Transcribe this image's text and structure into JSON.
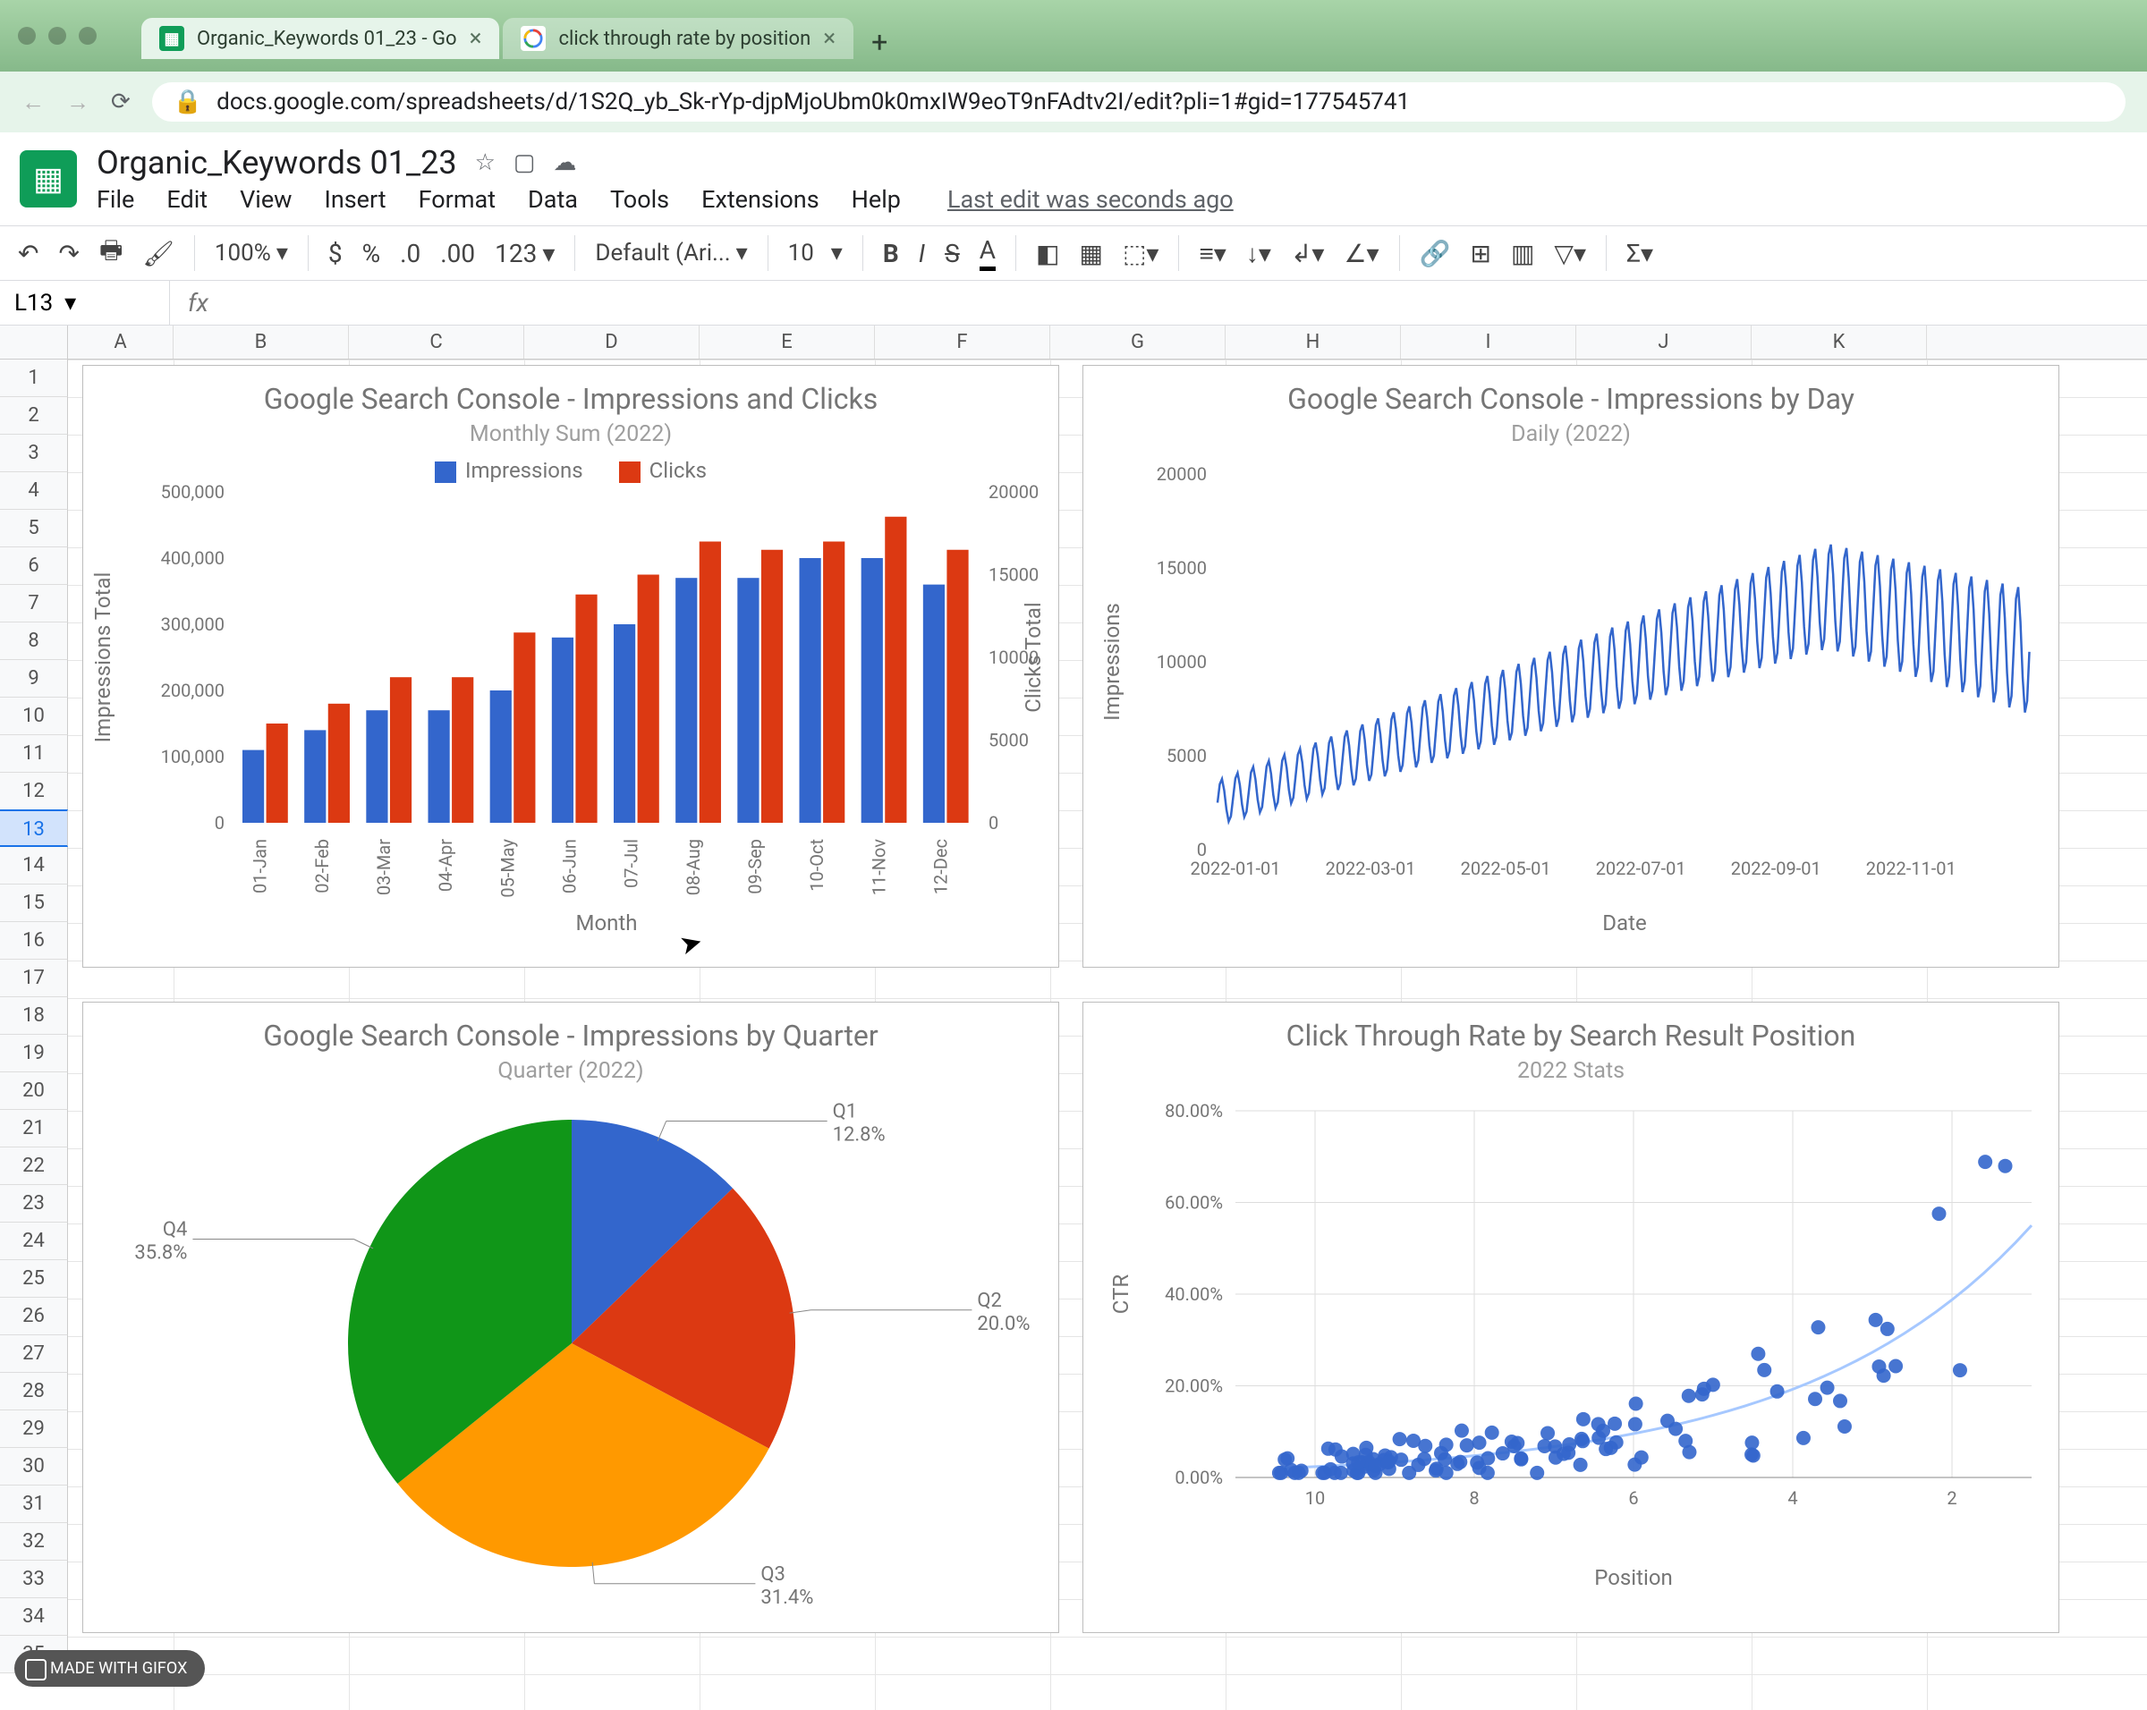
{
  "browser": {
    "tabs": [
      {
        "title": "Organic_Keywords 01_23 - Go",
        "favicon": "sheets",
        "active": true
      },
      {
        "title": "click through rate by position",
        "favicon": "google",
        "active": false
      }
    ],
    "url": "docs.google.com/spreadsheets/d/1S2Q_yb_Sk-rYp-djpMjoUbm0k0mxIW9eoT9nFAdtv2I/edit?pli=1#gid=177545741"
  },
  "doc": {
    "title": "Organic_Keywords 01_23",
    "menu": [
      "File",
      "Edit",
      "View",
      "Insert",
      "Format",
      "Data",
      "Tools",
      "Extensions",
      "Help"
    ],
    "last_edit": "Last edit was seconds ago"
  },
  "toolbar": {
    "zoom": "100%",
    "font": "Default (Ari...",
    "size": "10",
    "formats": "123"
  },
  "formula": {
    "cell": "L13",
    "value": ""
  },
  "columns": [
    "A",
    "B",
    "C",
    "D",
    "E",
    "F",
    "G",
    "H",
    "I",
    "J",
    "K"
  ],
  "row_count": 35,
  "chart_data": [
    {
      "id": "impressions_clicks",
      "type": "bar",
      "title": "Google Search Console - Impressions and Clicks",
      "subtitle": "Monthly Sum (2022)",
      "xlabel": "Month",
      "ylabel": "Impressions Total",
      "y2label": "Clicks Total",
      "categories": [
        "01-Jan",
        "02-Feb",
        "03-Mar",
        "04-Apr",
        "05-May",
        "06-Jun",
        "07-Jul",
        "08-Aug",
        "09-Sep",
        "10-Oct",
        "11-Nov",
        "12-Dec"
      ],
      "series": [
        {
          "name": "Impressions",
          "color": "#3366cc",
          "values": [
            110000,
            140000,
            170000,
            170000,
            200000,
            280000,
            300000,
            370000,
            370000,
            400000,
            400000,
            360000
          ],
          "axis": "y"
        },
        {
          "name": "Clicks",
          "color": "#dc3912",
          "values": [
            6000,
            7200,
            8800,
            8800,
            11500,
            13800,
            15000,
            17000,
            16500,
            17000,
            18500,
            16500
          ],
          "axis": "y2"
        }
      ],
      "ylim": [
        0,
        500000
      ],
      "y2lim": [
        0,
        20000
      ],
      "yticks": [
        0,
        100000,
        200000,
        300000,
        400000,
        500000
      ],
      "y2ticks": [
        0,
        5000,
        10000,
        15000,
        20000
      ]
    },
    {
      "id": "impressions_day",
      "type": "line",
      "title": "Google Search Console - Impressions by Day",
      "subtitle": "Daily (2022)",
      "xlabel": "Date",
      "ylabel": "Impressions",
      "ylim": [
        0,
        20000
      ],
      "yticks": [
        0,
        5000,
        10000,
        15000,
        20000
      ],
      "xticks": [
        "2022-01-01",
        "2022-03-01",
        "2022-05-01",
        "2022-07-01",
        "2022-09-01",
        "2022-11-01"
      ],
      "note": "weekly seasonal daily series, trough ~1500 rising to peak ~17000 then tapering to ~7000-14000",
      "approx_values": {
        "start_low": 1500,
        "start_high": 4000,
        "mid_low": 5500,
        "mid_high": 9000,
        "peak_low": 10000,
        "peak_high": 17000,
        "end_low": 7000,
        "end_high": 14000
      }
    },
    {
      "id": "impressions_quarter",
      "type": "pie",
      "title": "Google Search Console - Impressions by Quarter",
      "subtitle": "Quarter (2022)",
      "series": [
        {
          "name": "Share",
          "values": [
            {
              "label": "Q1",
              "pct": 12.8,
              "color": "#3366cc"
            },
            {
              "label": "Q2",
              "pct": 20.0,
              "color": "#dc3912"
            },
            {
              "label": "Q3",
              "pct": 31.4,
              "color": "#ff9900"
            },
            {
              "label": "Q4",
              "pct": 35.8,
              "color": "#109618"
            }
          ]
        }
      ]
    },
    {
      "id": "ctr_position",
      "type": "scatter",
      "title": "Click Through Rate by Search Result Position",
      "subtitle": "2022 Stats",
      "xlabel": "Position",
      "ylabel": "CTR",
      "xlim": [
        1,
        11
      ],
      "ylim": [
        0,
        0.8
      ],
      "x_reversed": true,
      "xticks": [
        10,
        8,
        6,
        4,
        2
      ],
      "yticks": [
        "0.00%",
        "20.00%",
        "40.00%",
        "60.00%",
        "80.00%"
      ],
      "trend": "exponential decay from ~50% at position 1 to ~3% at position 10",
      "n_points_approx": 120
    }
  ],
  "gifox": "MADE WITH GIFOX"
}
